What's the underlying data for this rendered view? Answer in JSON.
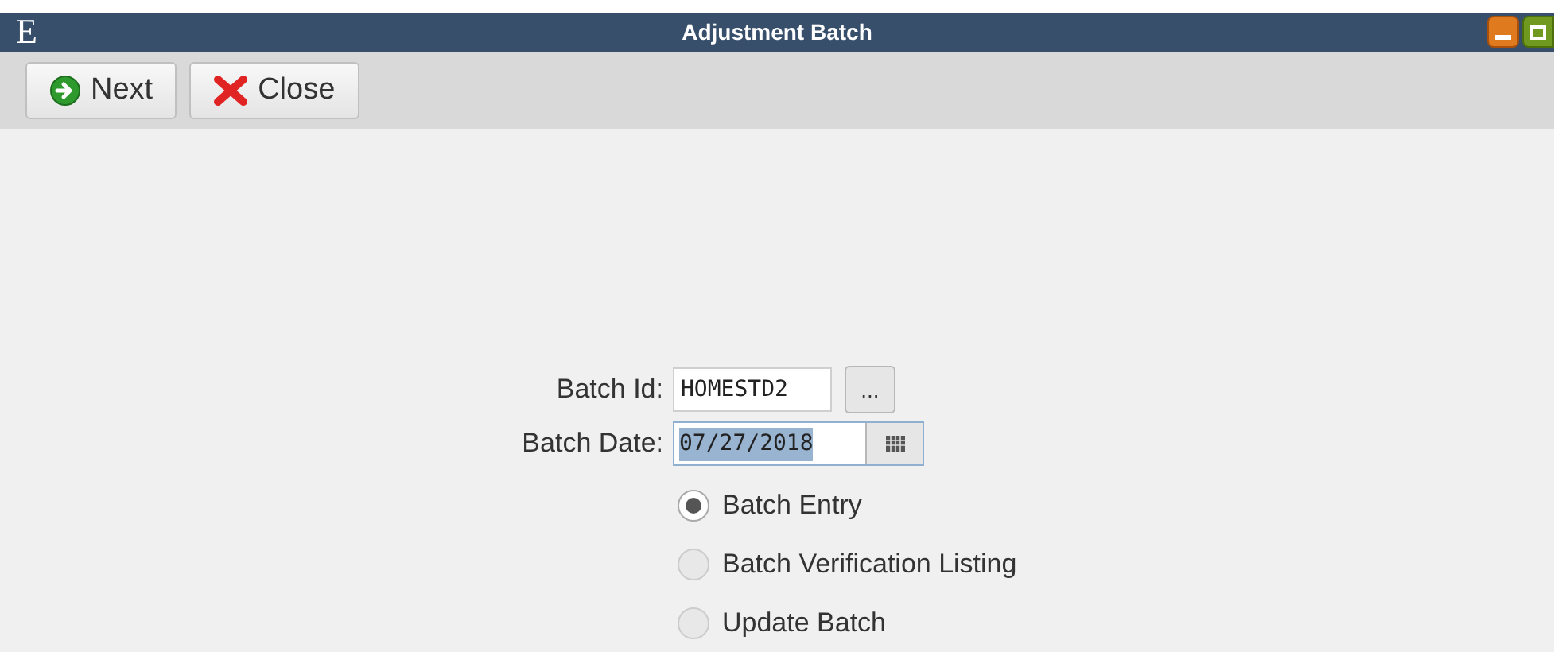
{
  "window": {
    "logo": "E",
    "title": "Adjustment Batch"
  },
  "toolbar": [
    {
      "kind": "next",
      "label": "Next"
    },
    {
      "kind": "close",
      "label": "Close"
    }
  ],
  "form": {
    "batch_id": {
      "label": "Batch Id:",
      "value": "HOMESTD2",
      "lookup": "..."
    },
    "batch_date": {
      "label": "Batch Date:",
      "value": "07/27/2018"
    },
    "options": [
      {
        "label": "Batch Entry",
        "selected": true
      },
      {
        "label": "Batch Verification Listing",
        "selected": false
      },
      {
        "label": "Update Batch",
        "selected": false
      }
    ]
  }
}
